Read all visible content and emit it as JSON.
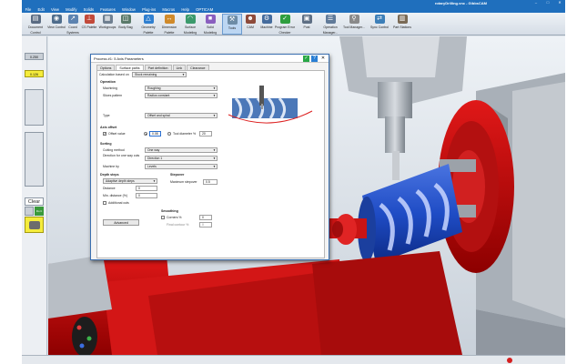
{
  "app": {
    "title": "rotaryDrilling.vnc - GibbsCAM",
    "menu": [
      "File",
      "Edit",
      "View",
      "Modify",
      "Solids",
      "Features",
      "Window",
      "Plug-ins",
      "Macros",
      "Help",
      "OPTICAM"
    ],
    "toolbar": [
      {
        "label": "Document Control",
        "icon": "document-icon",
        "color": "#5a6b82"
      },
      {
        "label": "View Control",
        "icon": "view-icon",
        "color": "#4f6d8c"
      },
      {
        "label": "Coord Systems",
        "icon": "coord-icon",
        "color": "#5d83b0"
      },
      {
        "label": "CS Palette",
        "icon": "cs-palette-icon",
        "color": "#c24a3a"
      },
      {
        "label": "Workgroups",
        "icon": "workgroup-icon",
        "color": "#6f7f90"
      },
      {
        "label": "Body Bag",
        "icon": "body-bag-icon",
        "color": "#5b7a6a"
      },
      {
        "label": "Geometry Palette",
        "icon": "geometry-icon",
        "color": "#2f7fd0"
      },
      {
        "label": "Dimension Palette",
        "icon": "dimension-icon",
        "color": "#d08a2a"
      },
      {
        "label": "Surface Modeling",
        "icon": "surface-icon",
        "color": "#3b9a6c"
      },
      {
        "label": "Solid Modeling",
        "icon": "solid-icon",
        "color": "#8a5fbf"
      },
      {
        "label": "Tools",
        "icon": "tools-icon",
        "color": "#6d8ca6"
      },
      {
        "label": "CAM",
        "icon": "cam-icon",
        "color": "#8d4a3a"
      },
      {
        "label": "Machine",
        "icon": "machine-icon",
        "color": "#456c9d"
      },
      {
        "label": "Program Error Checker",
        "icon": "check-icon",
        "color": "#2e9e3e"
      },
      {
        "label": "Post",
        "icon": "post-icon",
        "color": "#5e6f84"
      },
      {
        "label": "Operation Manager...",
        "icon": "op-manager-icon",
        "color": "#607a99"
      },
      {
        "label": "Tool Manager...",
        "icon": "tool-manager-icon",
        "color": "#8a8a8a"
      },
      {
        "label": "Sync Control",
        "icon": "sync-icon",
        "color": "#3d7fb8"
      },
      {
        "label": "Part Stations",
        "icon": "part-stations-icon",
        "color": "#7a6a55"
      }
    ]
  },
  "left_panel": {
    "top_value_1": "0.250",
    "top_value_2": "0.126",
    "clear_label": "Clear",
    "do_it_label": "Do It"
  },
  "dialog": {
    "title": "Process #1: 5 Axis Parameters",
    "tabs": [
      "Options",
      "Surface paths",
      "Part definition",
      "Link",
      "Clearance"
    ],
    "calc_based_on_label": "Calculation based on",
    "calc_based_on_value": "Stock remaining",
    "operation_group": "Operation",
    "machining_label": "Machining",
    "machining_value": "Roughing",
    "slices_label": "Slices pattern",
    "slices_value": "Radius constant",
    "type_label": "Type",
    "type_value": "Offset and spiral",
    "axis_offset_group": "Axis offset",
    "offset_value_label": "Offset value",
    "offset_value": "0.08",
    "tool_diameter_label": "Tool diameter %",
    "tool_diameter_value": "20",
    "sorting_group": "Sorting",
    "cutting_method_label": "Cutting method",
    "cutting_method_value": "One way",
    "direction_label": "Direction for one way cuts",
    "direction_value": "Direction 1",
    "machine_by_label": "Machine by",
    "machine_by_value": "Levels",
    "depth_steps_group": "Depth steps",
    "depth_steps_value": "Adaptive depth steps",
    "distance_label": "Distance",
    "distance_value": "0",
    "min_distance_label": "Min. distance (%)",
    "min_distance_value": "0",
    "additional_cuts_label": "Additional cuts",
    "stepover_group": "Stepover",
    "max_stepover_label": "Maximum stepover",
    "max_stepover_value": "0.5",
    "smoothing_group": "Smoothing",
    "corners_label": "Corners %",
    "corners_value": "0",
    "final_contour_label": "Final contour %",
    "final_contour_value": "0",
    "advanced_button": "Advanced"
  }
}
